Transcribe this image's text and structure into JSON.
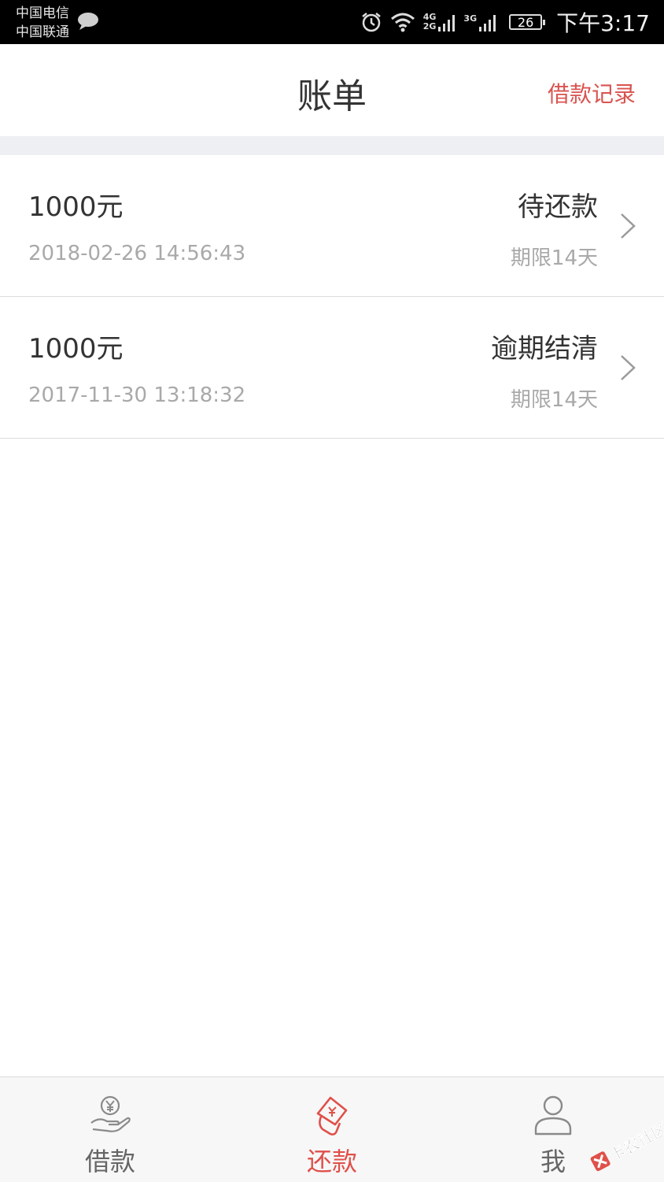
{
  "status_bar": {
    "carrier_1": "中国电信",
    "carrier_2": "中国联通",
    "net_1_top": "4G",
    "net_1_bottom": "2G",
    "net_2": "3G",
    "battery": "26",
    "time": "下午3:17"
  },
  "header": {
    "title": "账单",
    "loan_record": "借款记录"
  },
  "bills": [
    {
      "amount": "1000元",
      "date": "2018-02-26 14:56:43",
      "status": "待还款",
      "term": "期限14天"
    },
    {
      "amount": "1000元",
      "date": "2017-11-30 13:18:32",
      "status": "逾期结清",
      "term": "期限14天"
    }
  ],
  "tabbar": {
    "loan": "借款",
    "repay": "还款",
    "me": "我",
    "active": "repay"
  },
  "watermark": {
    "text": "卡农社区"
  },
  "colors": {
    "accent": "#e0504a",
    "link": "#d9534f",
    "muted": "#a9a9a9"
  }
}
